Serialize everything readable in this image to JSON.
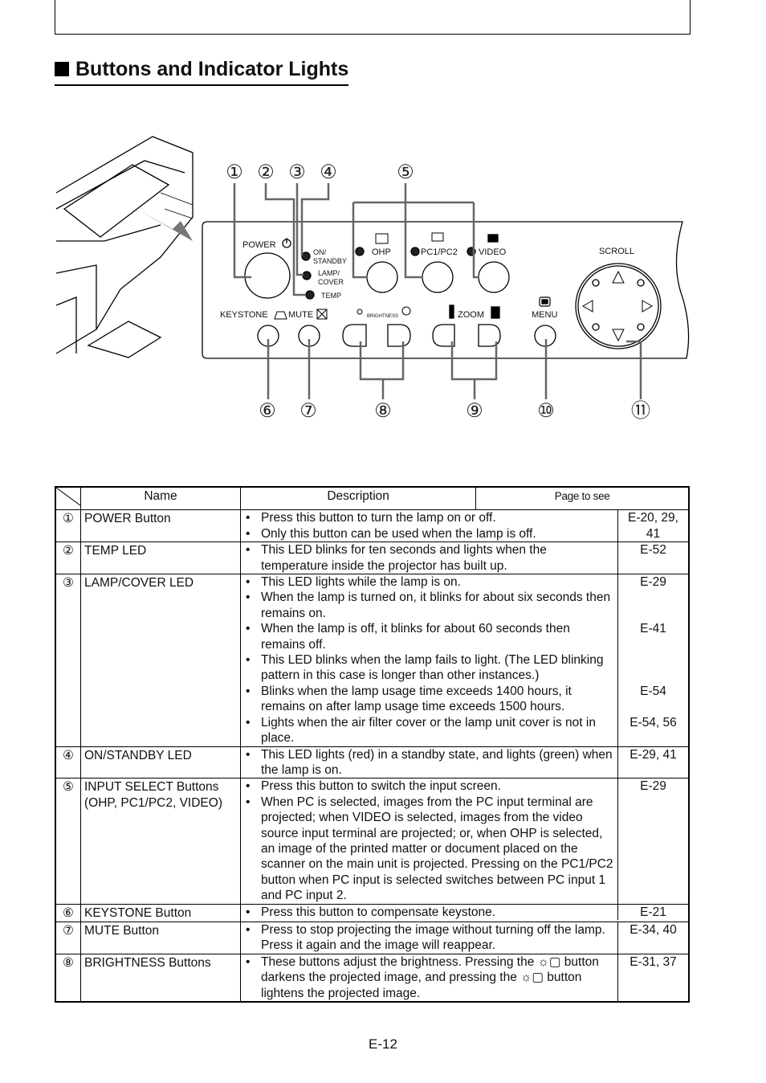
{
  "title": "Buttons and Indicator Lights",
  "panel": {
    "power": "POWER",
    "on_standby": [
      "ON/",
      "STANDBY"
    ],
    "lamp_cover": [
      "LAMP/",
      "COVER"
    ],
    "temp": "TEMP",
    "ohp": "OHP",
    "pc": "PC1/PC2",
    "video": "VIDEO",
    "scroll": "SCROLL",
    "keystone": "KEYSTONE",
    "mute": "MUTE",
    "brightness": "BRIGHTNESS",
    "zoom": "ZOOM",
    "menu": "MENU"
  },
  "callouts": {
    "top": [
      "①",
      "②",
      "③",
      "④",
      "⑤"
    ],
    "bottom": [
      "⑥",
      "⑦",
      "⑧",
      "⑨",
      "⑩",
      "⑪"
    ]
  },
  "table": {
    "headers": {
      "name": "Name",
      "description": "Description",
      "page": "Page to see"
    },
    "rows": [
      {
        "num": "①",
        "name": [
          "POWER Button"
        ],
        "items": [
          {
            "text": "Press this button to turn the lamp on or off.",
            "page": "E-20, 29,"
          },
          {
            "text": "Only this button can be used when the lamp is off.",
            "page": "41"
          }
        ]
      },
      {
        "num": "②",
        "name": [
          "TEMP LED"
        ],
        "items": [
          {
            "text": "This LED blinks for ten seconds and lights when the temperature inside the projector has built up.",
            "page": "E-52"
          }
        ]
      },
      {
        "num": "③",
        "name": [
          "LAMP/COVER LED"
        ],
        "items": [
          {
            "text": "This LED lights while the lamp is on.",
            "page": "E-29"
          },
          {
            "text": "When the lamp is turned on, it blinks for about six seconds then remains on.",
            "page": ""
          },
          {
            "text": "When the lamp is off, it blinks for about 60 seconds then remains off.",
            "page": "E-41"
          },
          {
            "text": "This LED blinks when the lamp fails to light. (The LED blinking pattern in this case is longer than other instances.)",
            "page": ""
          },
          {
            "text": "Blinks when the lamp usage time exceeds 1400 hours, it remains on after lamp usage time exceeds 1500 hours.",
            "page": "E-54"
          },
          {
            "text": "Lights when the air filter cover or the lamp unit cover is not in place.",
            "page": "E-54, 56"
          }
        ]
      },
      {
        "num": "④",
        "name": [
          "ON/STANDBY LED"
        ],
        "items": [
          {
            "text": "This LED lights (red) in a standby state, and lights (green) when the lamp is on.",
            "page": "E-29, 41"
          }
        ]
      },
      {
        "num": "⑤",
        "name": [
          "INPUT SELECT Buttons",
          "(OHP, PC1/PC2, VIDEO)"
        ],
        "items": [
          {
            "text": "Press this button to switch the input screen.",
            "page": "E-29"
          },
          {
            "text": "When PC is selected, images from the PC input terminal are projected; when VIDEO is selected, images from the video source input terminal are projected; or, when OHP is selected, an image of the printed matter or document placed on the scanner on the main unit is projected. Pressing on the PC1/PC2 button when PC input is selected switches between PC input 1 and PC input 2.",
            "page": ""
          }
        ]
      },
      {
        "num": "⑥",
        "name": [
          "KEYSTONE Button"
        ],
        "items": [
          {
            "text": "Press this button to compensate keystone.",
            "page": "E-21"
          }
        ]
      },
      {
        "num": "⑦",
        "name": [
          "MUTE Button"
        ],
        "items": [
          {
            "text": "Press to stop projecting the image without turning off the lamp. Press it again and the image will reappear.",
            "page": "E-34, 40"
          }
        ]
      },
      {
        "num": "⑧",
        "name": [
          "BRIGHTNESS Buttons"
        ],
        "items": [
          {
            "text": "These buttons adjust the brightness. Pressing the ☼▢ button darkens the projected image, and pressing the ☼▢ button lightens the projected image.",
            "page": "E-31, 37"
          }
        ]
      }
    ]
  },
  "footer": "E-12"
}
